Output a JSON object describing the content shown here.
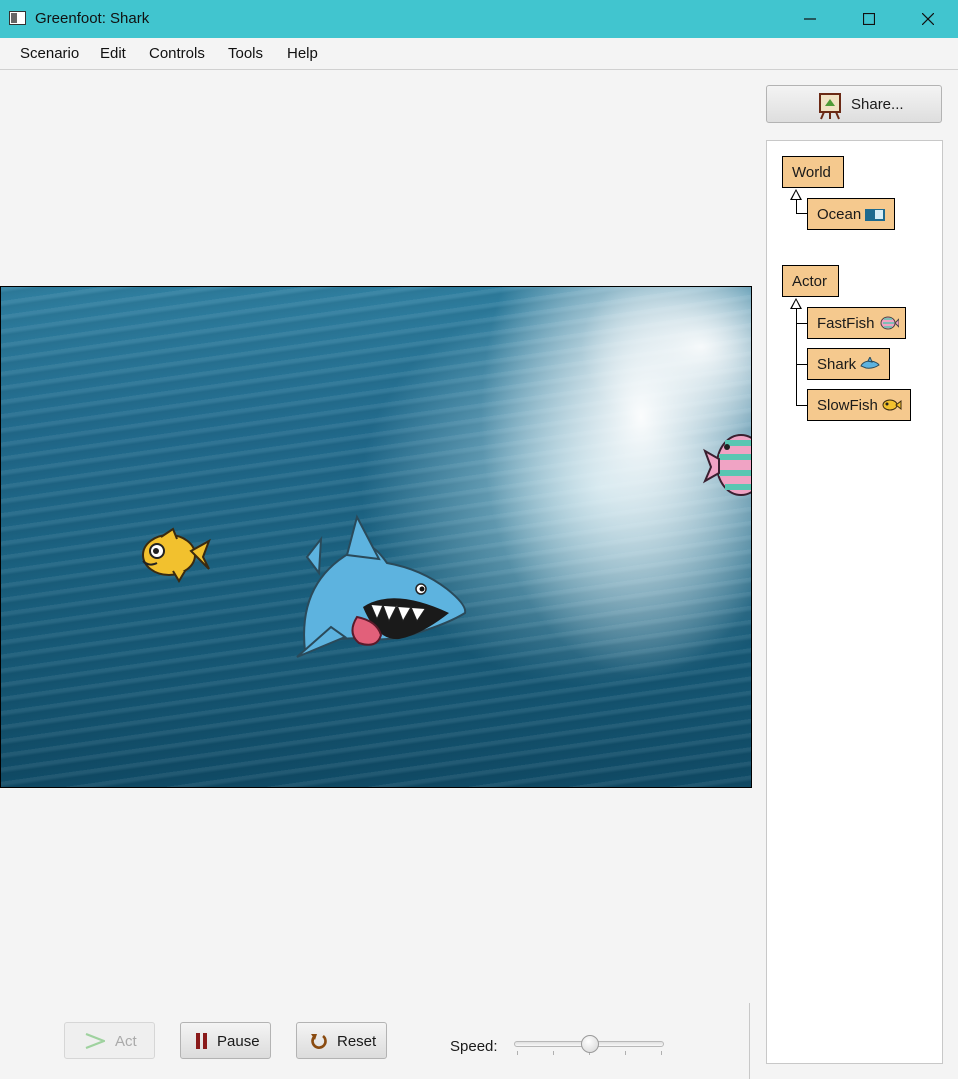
{
  "window": {
    "title": "Greenfoot: Shark"
  },
  "menu": [
    "Scenario",
    "Edit",
    "Controls",
    "Tools",
    "Help"
  ],
  "share_label": "Share...",
  "classes": {
    "world_root": "World",
    "world_sub": "Ocean",
    "actor_root": "Actor",
    "actor_subs": [
      "FastFish",
      "Shark",
      "SlowFish"
    ]
  },
  "controls": {
    "act": "Act",
    "pause": "Pause",
    "reset": "Reset",
    "speed_label": "Speed:",
    "speed_value": 0.5
  },
  "colors": {
    "titlebar": "#41c5cf",
    "class_box": "#f5c98e"
  },
  "icons": [
    "app-icon",
    "minimize-icon",
    "maximize-icon",
    "close-icon",
    "share-easel-icon",
    "ocean-icon",
    "fastfish-icon",
    "shark-icon",
    "slowfish-icon",
    "act-arrow-icon",
    "pause-icon",
    "reset-icon"
  ]
}
